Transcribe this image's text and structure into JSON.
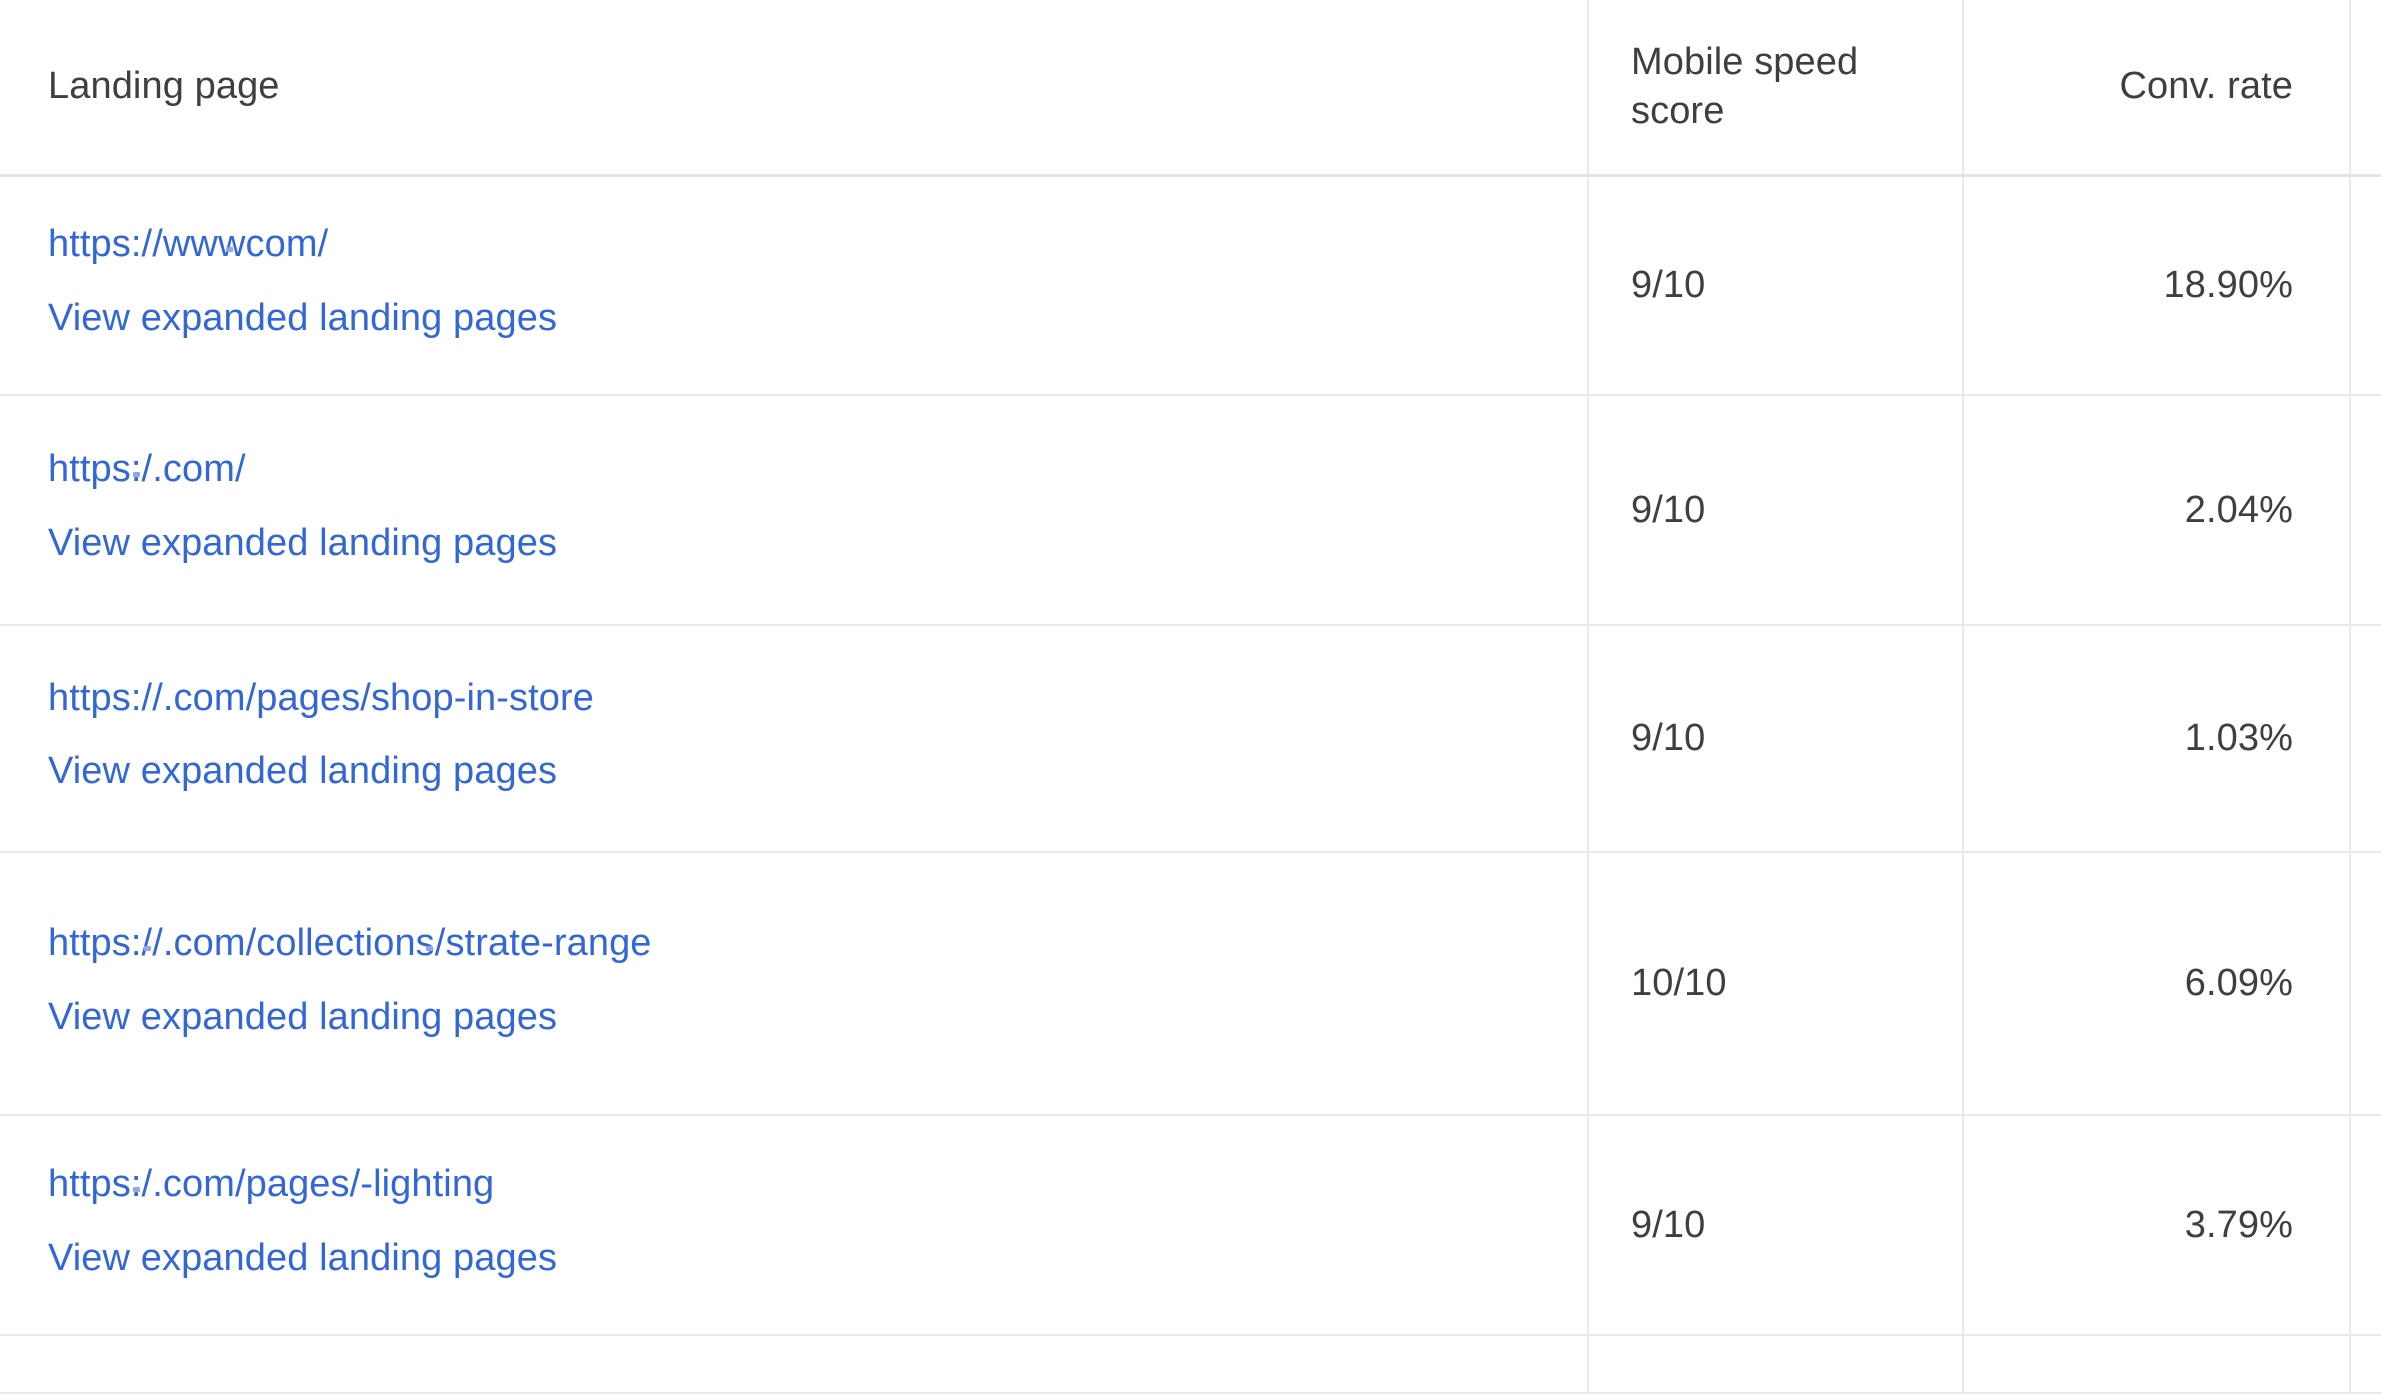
{
  "table": {
    "columns": [
      {
        "id": "landing_page",
        "label": "Landing page",
        "align": "left"
      },
      {
        "id": "mobile_speed_score",
        "label_line1": "Mobile speed",
        "label_line2": "score",
        "align": "left"
      },
      {
        "id": "conv_rate",
        "label": "Conv. rate",
        "align": "right"
      }
    ],
    "expand_link_label": "View expanded landing pages",
    "link_color": "#3367d6",
    "text_color": "#3c4043",
    "border_color": "#e8eaed",
    "rows": [
      {
        "url_prefix": "https://www",
        "url_redacted_1": "                 ",
        "url_suffix": "com/",
        "url_tail": "",
        "expand_link": "View expanded landing pages",
        "mobile_speed_score": "9/10",
        "conv_rate": "18.90%"
      },
      {
        "url_prefix": "https:/",
        "url_redacted_1": "                  ",
        "url_suffix": ".com/",
        "url_tail": "",
        "expand_link": "View expanded landing pages",
        "mobile_speed_score": "9/10",
        "conv_rate": "2.04%"
      },
      {
        "url_prefix": "https://",
        "url_redacted_1": "                    ",
        "url_suffix": ".com/pages/shop-in-store",
        "url_tail": "",
        "expand_link": "View expanded landing pages",
        "mobile_speed_score": "9/10",
        "conv_rate": "1.03%"
      },
      {
        "url_prefix": "https://",
        "url_redacted_1": "               ",
        "url_suffix": ".com/collections/",
        "url_redacted_2": "                     ",
        "url_tail": "strate-range",
        "expand_link": "View expanded landing pages",
        "mobile_speed_score": "10/10",
        "conv_rate": "6.09%"
      },
      {
        "url_prefix": "https:/",
        "url_redacted_1": "                  ",
        "url_suffix": ".com/pages/",
        "url_redacted_2": "   ",
        "url_tail": "-lighting",
        "expand_link": "View expanded landing pages",
        "mobile_speed_score": "9/10",
        "conv_rate": "3.79%"
      }
    ]
  }
}
